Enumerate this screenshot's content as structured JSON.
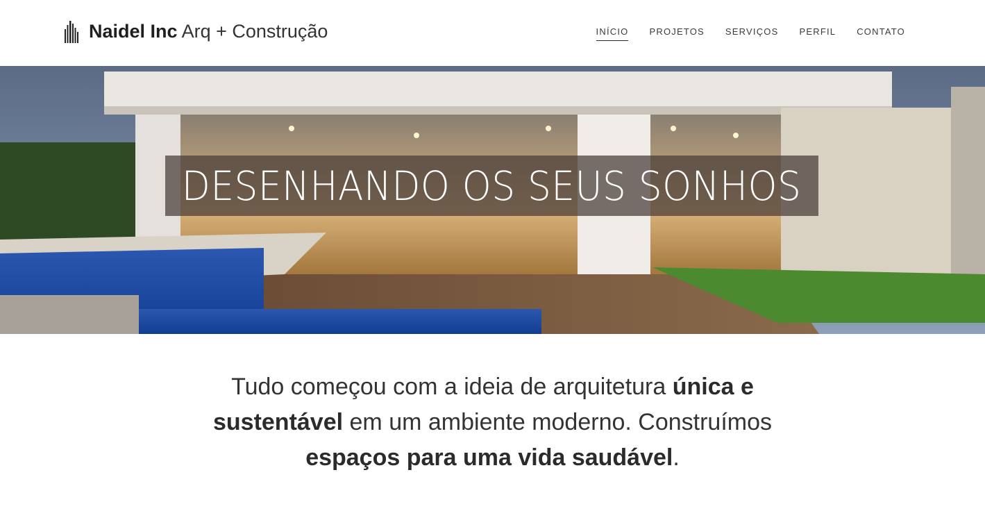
{
  "header": {
    "brand_bold": "Naidel Inc",
    "brand_light": "Arq + Construção",
    "logo_icon": "building-icon"
  },
  "nav": {
    "items": [
      {
        "label": "INÍCIO",
        "active": true
      },
      {
        "label": "PROJETOS",
        "active": false
      },
      {
        "label": "SERVIÇOS",
        "active": false
      },
      {
        "label": "PERFIL",
        "active": false
      },
      {
        "label": "CONTATO",
        "active": false
      }
    ]
  },
  "hero": {
    "title": "DESENHANDO OS SEUS SONHOS"
  },
  "intro": {
    "part1": "Tudo começou com a ideia de arquitetura ",
    "bold1": "única e sustentável",
    "part2": " em um ambiente moderno. Construímos ",
    "bold2": "espaços para uma vida saudável",
    "part3": "."
  },
  "colors": {
    "background": "#ffffff",
    "text": "#2b2b2b",
    "caption_bg": "#463c37"
  }
}
